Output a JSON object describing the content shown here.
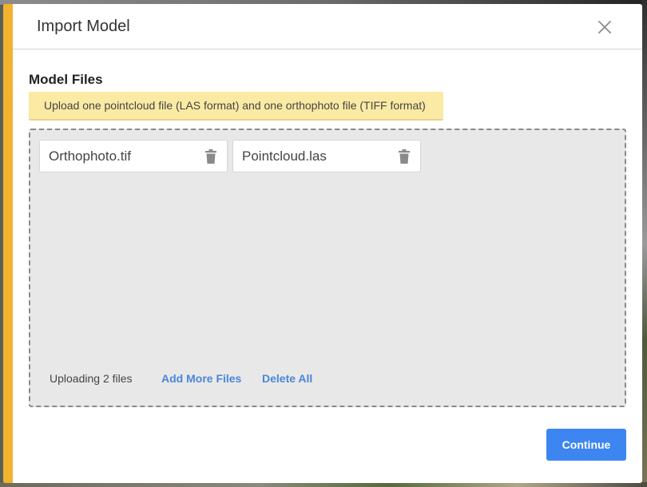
{
  "dialog": {
    "title": "Import Model",
    "close_icon": "close-icon"
  },
  "section": {
    "title": "Model Files",
    "notice": "Upload one pointcloud file (LAS format) and one orthophoto file (TIFF format)"
  },
  "files": [
    {
      "name": "Orthophoto.tif",
      "icon": "trash-icon"
    },
    {
      "name": "Pointcloud.las",
      "icon": "trash-icon"
    }
  ],
  "dropzone_footer": {
    "status": "Uploading 2 files",
    "add_more_label": "Add More Files",
    "delete_all_label": "Delete All"
  },
  "actions": {
    "continue_label": "Continue"
  },
  "colors": {
    "accent": "#f2b32e",
    "primary": "#3d85f0",
    "link": "#4a86d9",
    "notice_bg": "#fbeaa4"
  }
}
